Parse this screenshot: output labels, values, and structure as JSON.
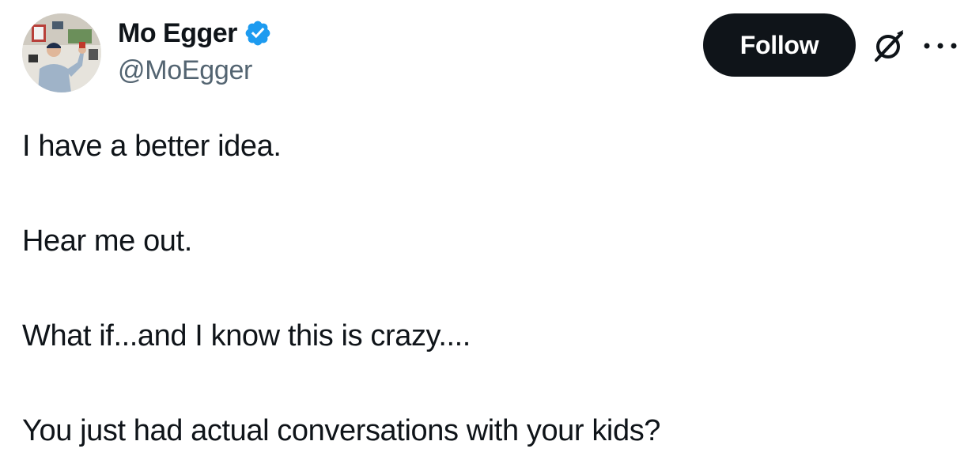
{
  "author": {
    "display_name": "Mo Egger",
    "handle": "@MoEgger",
    "verified": true,
    "verified_color": "#1d9bf0"
  },
  "actions": {
    "follow_label": "Follow",
    "grok_icon": "grok-icon",
    "more_icon": "more-icon"
  },
  "tweet": {
    "lines": [
      "I have a better idea.",
      "Hear me out.",
      "What if...and I know this is crazy....",
      "You just had actual conversations with your kids?"
    ]
  },
  "colors": {
    "text": "#0f1419",
    "secondary": "#536471",
    "button_bg": "#0f1419",
    "button_text": "#ffffff"
  }
}
